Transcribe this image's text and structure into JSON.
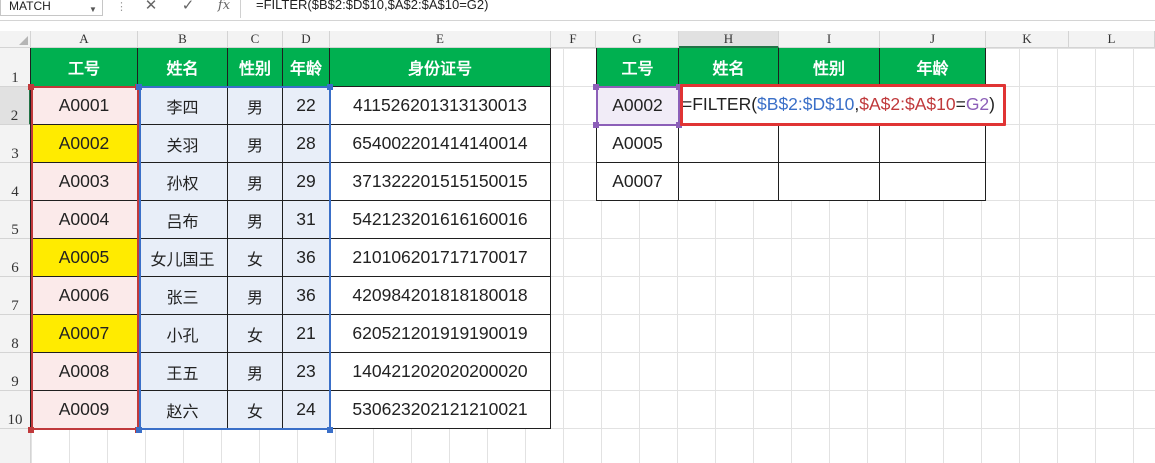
{
  "formula_bar": {
    "name_box": "MATCH",
    "cancel_icon": "✕",
    "enter_icon": "✓",
    "fx_label": "fx",
    "formula": "=FILTER($B$2:$D$10,$A$2:$A$10=G2)"
  },
  "columns": [
    "A",
    "B",
    "C",
    "D",
    "E",
    "F",
    "G",
    "H",
    "I",
    "J",
    "K",
    "L"
  ],
  "rows": [
    "1",
    "2",
    "3",
    "4",
    "5",
    "6",
    "7",
    "8",
    "9",
    "10"
  ],
  "table": {
    "headers": [
      "工号",
      "姓名",
      "性别",
      "年龄",
      "身份证号"
    ],
    "records": [
      [
        "A0001",
        "李四",
        "男",
        "22",
        "411526201313130013"
      ],
      [
        "A0002",
        "关羽",
        "男",
        "28",
        "654002201414140014"
      ],
      [
        "A0003",
        "孙权",
        "男",
        "29",
        "371322201515150015"
      ],
      [
        "A0004",
        "吕布",
        "男",
        "31",
        "542123201616160016"
      ],
      [
        "A0005",
        "女儿国王",
        "女",
        "36",
        "210106201717170017"
      ],
      [
        "A0006",
        "张三",
        "男",
        "36",
        "420984201818180018"
      ],
      [
        "A0007",
        "小孔",
        "女",
        "21",
        "620521201919190019"
      ],
      [
        "A0008",
        "王五",
        "男",
        "23",
        "140421202020200020"
      ],
      [
        "A0009",
        "赵六",
        "女",
        "24",
        "530623202121210021"
      ]
    ]
  },
  "lookup": {
    "headers": [
      "工号",
      "姓名",
      "性别",
      "年龄"
    ],
    "ids": [
      "A0002",
      "A0005",
      "A0007"
    ],
    "formula_parts": [
      "=FILTER(",
      "$B$2:$D$10",
      ",",
      "$A$2:$A$10",
      "=",
      "G2",
      ")"
    ]
  },
  "colors": {
    "header_green": "#00b050",
    "highlight_yellow": "#ffeb00",
    "ref_blue": "#3a6fc8",
    "ref_red": "#c0393b",
    "ref_purple": "#8c5fb8",
    "formula_box_red": "#e03434"
  }
}
